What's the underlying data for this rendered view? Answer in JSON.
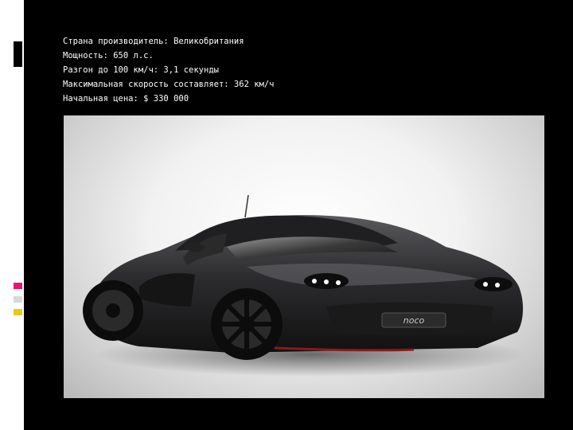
{
  "slide": {
    "specs": [
      "Страна производитель: Великобритания",
      "Мощность: 650 л.с.",
      "Разгон до 100 км/ч: 3,1 секунды",
      "Максимальная скорость составляет: 362 км/ч",
      "Начальная цена: $ 330 000"
    ]
  },
  "photo": {
    "badge": "noco"
  },
  "colors": {
    "background": "#000000",
    "text": "#ffffff",
    "accent_pink": "#e8156f",
    "accent_gray": "#d8d8d8",
    "accent_yellow": "#e8c91a"
  }
}
